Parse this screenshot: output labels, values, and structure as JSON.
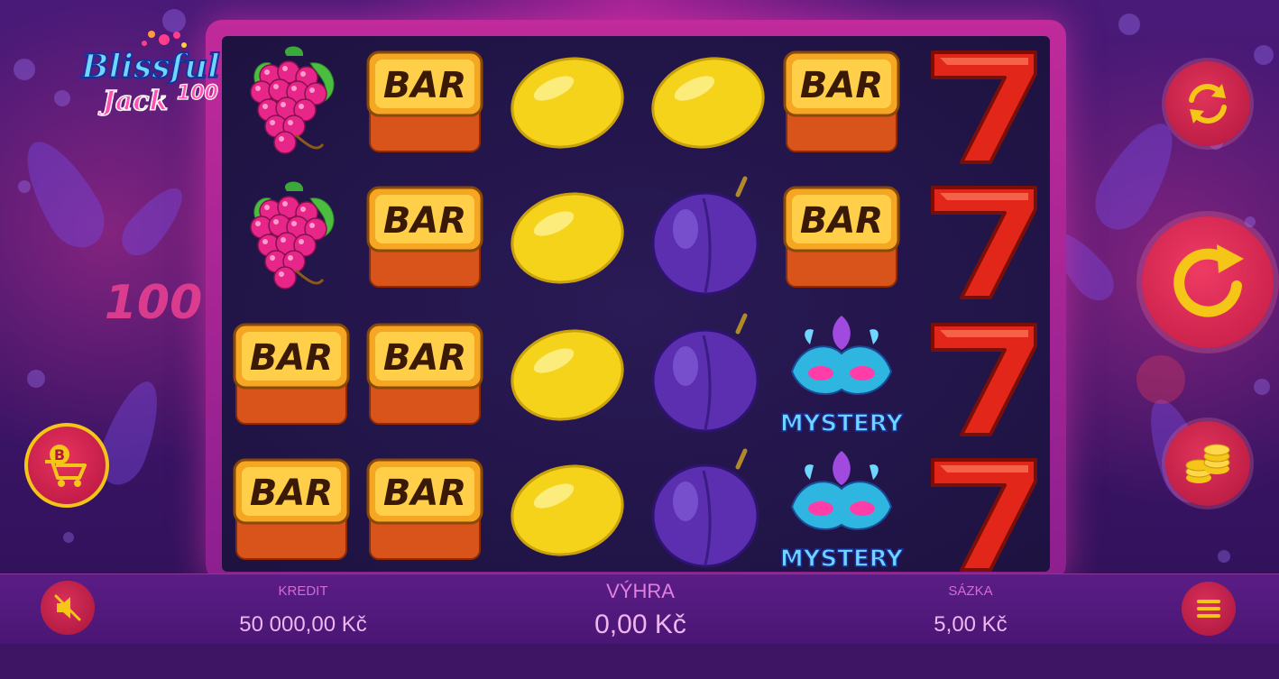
{
  "game": {
    "logo_line1": "Blissful",
    "logo_line2": "Jack",
    "logo_number": "100",
    "deco_number": "100"
  },
  "reels": [
    [
      "grapes",
      "bar",
      "lemon",
      "lemon",
      "bar",
      "seven"
    ],
    [
      "grapes",
      "bar",
      "lemon",
      "plum",
      "bar",
      "seven"
    ],
    [
      "bar",
      "bar",
      "lemon",
      "plum",
      "mystery",
      "seven"
    ],
    [
      "bar",
      "bar",
      "lemon",
      "plum",
      "mystery",
      "seven"
    ]
  ],
  "symbols": {
    "bar_text": "BAR",
    "seven_text": "7",
    "mystery_text": "MYSTERY"
  },
  "status": {
    "kredit_label": "KREDIT",
    "kredit_value": "50 000,00 Kč",
    "vyhra_label": "VÝHRA",
    "vyhra_value": "0,00 Kč",
    "sazka_label": "SÁZKA",
    "sazka_value": "5,00 Kč"
  },
  "buttons": {
    "autoplay_icon": "autoplay-arrows-icon",
    "spin_icon": "spin-arrow-icon",
    "bet_icon": "coins-icon",
    "shop_icon": "bonus-buy-cart-icon",
    "shop_badge": "B",
    "mute_icon": "speaker-muted-icon",
    "menu_icon": "hamburger-icon"
  },
  "colors": {
    "button_red": "#c01a44",
    "accent_gold": "#f5c518",
    "label_pink": "#d26bd4",
    "value_pink": "#f0b6f0"
  }
}
